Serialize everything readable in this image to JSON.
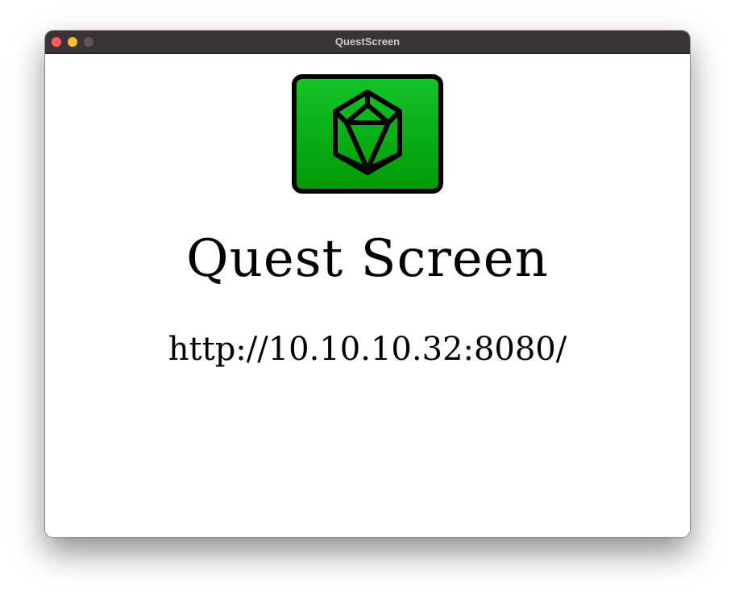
{
  "window": {
    "title": "QuestScreen",
    "controls": {
      "close_color": "#ff5f57",
      "minimize_color": "#febc2e",
      "zoom_color": "#5c5759"
    }
  },
  "main": {
    "logo_icon": "d20-icosahedron-icon",
    "logo_color": "#09b521",
    "title": "Quest Screen",
    "url": "http://10.10.10.32:8080/"
  }
}
